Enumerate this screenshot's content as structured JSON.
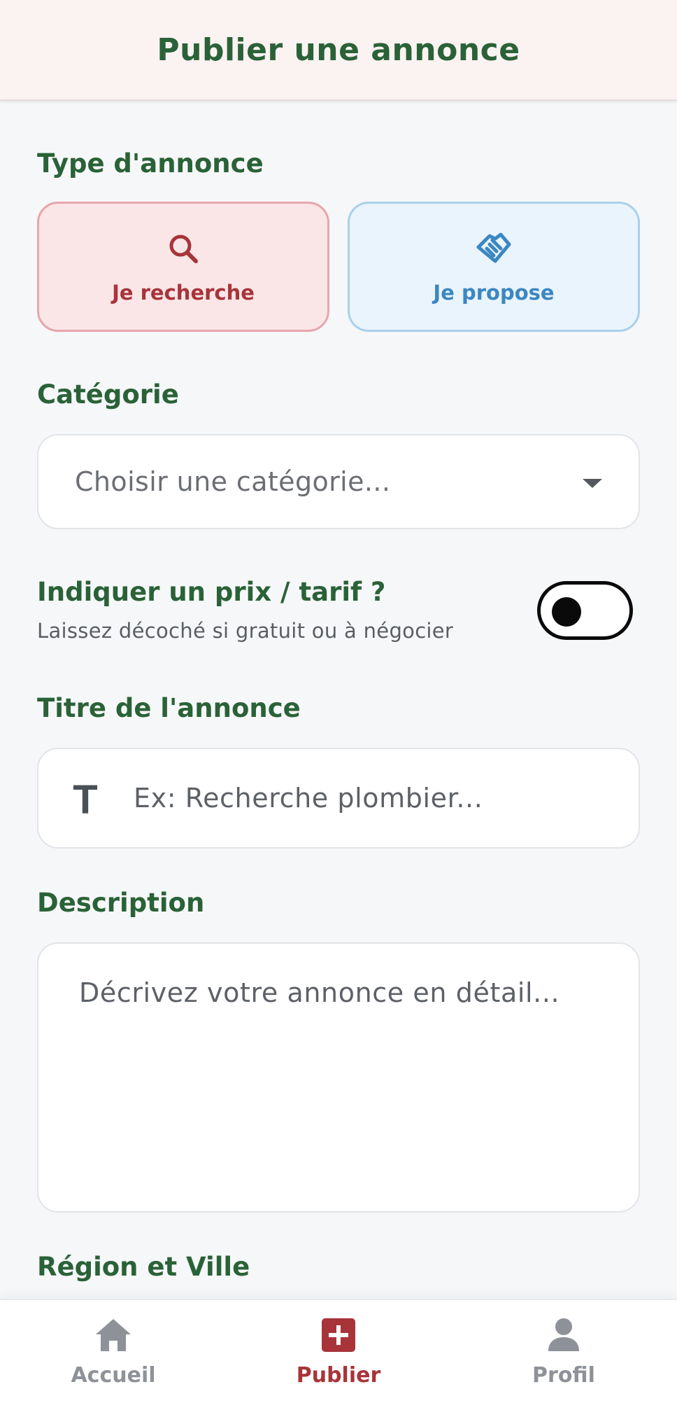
{
  "header": {
    "title": "Publier une annonce"
  },
  "form": {
    "type_label": "Type d'annonce",
    "type_options": [
      {
        "label": "Je recherche",
        "icon": "search-icon",
        "color": "#a8343a",
        "selected": true
      },
      {
        "label": "Je propose",
        "icon": "handshake-icon",
        "color": "#3b87c2",
        "selected": false
      }
    ],
    "category_label": "Catégorie",
    "category_placeholder": "Choisir une catégorie...",
    "price_label": "Indiquer un prix / tarif ?",
    "price_hint": "Laissez décoché si gratuit ou à négocier",
    "price_toggle_on": false,
    "title_label": "Titre de l'annonce",
    "title_icon_glyph": "T",
    "title_placeholder": "Ex: Recherche plombier...",
    "description_label": "Description",
    "description_placeholder": "Décrivez votre annonce en détail...",
    "region_label": "Région et Ville"
  },
  "bottom_nav": {
    "items": [
      {
        "label": "Accueil",
        "icon": "home-icon",
        "active": false
      },
      {
        "label": "Publier",
        "icon": "plus-square-icon",
        "active": true
      },
      {
        "label": "Profil",
        "icon": "user-icon",
        "active": false
      }
    ]
  },
  "colors": {
    "primary_green": "#2a6237",
    "accent_red": "#a8343a",
    "accent_blue": "#3b87c2"
  }
}
